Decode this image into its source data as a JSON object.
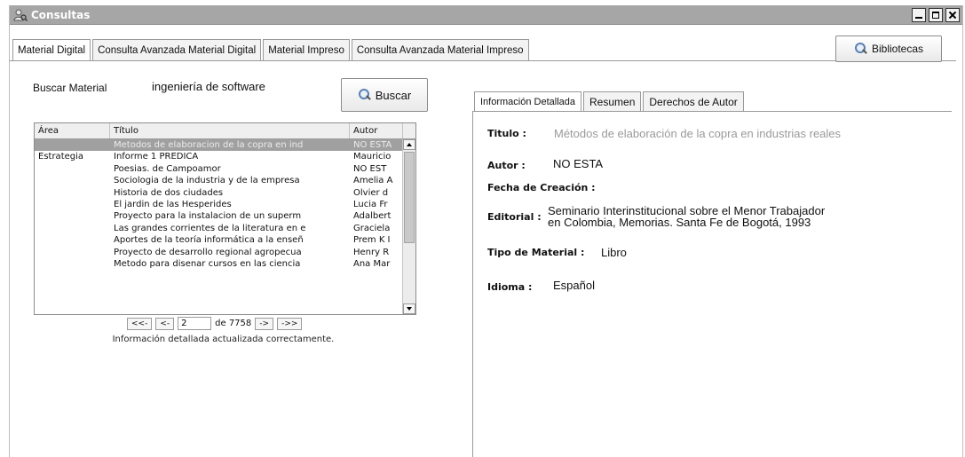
{
  "window": {
    "title": "Consultas"
  },
  "tabs": [
    {
      "label": "Material Digital",
      "active": true
    },
    {
      "label": "Consulta Avanzada Material Digital",
      "active": false
    },
    {
      "label": "Material Impreso",
      "active": false
    },
    {
      "label": "Consulta Avanzada Material Impreso",
      "active": false
    }
  ],
  "bibliotecas_button": "Bibliotecas",
  "search": {
    "label": "Buscar Material",
    "value": "ingeniería de software",
    "button": "Buscar"
  },
  "results_table": {
    "columns": [
      "Área",
      "Título",
      "Autor"
    ],
    "rows": [
      {
        "area": "",
        "titulo": "Metodos de elaboracion de la copra en ind",
        "autor": "NO ESTA",
        "selected": true
      },
      {
        "area": "Estrategia",
        "titulo": "Informe 1 PREDICA",
        "autor": "Mauricio",
        "selected": false
      },
      {
        "area": "",
        "titulo": "Poesias. de Campoamor",
        "autor": "NO EST",
        "selected": false
      },
      {
        "area": "",
        "titulo": "Sociologia de la industria y de la empresa",
        "autor": "Amelia A",
        "selected": false
      },
      {
        "area": "",
        "titulo": "Historia de dos ciudades",
        "autor": "Olvier d",
        "selected": false
      },
      {
        "area": "",
        "titulo": "El jardin de las Hesperides",
        "autor": "Lucia Fr",
        "selected": false
      },
      {
        "area": "",
        "titulo": "Proyecto para la instalacion de un superm",
        "autor": "Adalbert",
        "selected": false
      },
      {
        "area": "",
        "titulo": "Las grandes corrientes de la literatura en e",
        "autor": "Graciela",
        "selected": false
      },
      {
        "area": "",
        "titulo": "Aportes de la teoría informática a la enseñ",
        "autor": "Prem K I",
        "selected": false
      },
      {
        "area": "",
        "titulo": "Proyecto de desarrollo regional agropecua",
        "autor": "Henry R",
        "selected": false
      },
      {
        "area": "",
        "titulo": "Metodo para disenar cursos en las ciencia",
        "autor": "Ana Mar",
        "selected": false
      }
    ]
  },
  "pager": {
    "first": "<<-",
    "prev": "<-",
    "page": "2",
    "of_label": "de 7758",
    "next": "->",
    "last": "->>"
  },
  "status_message": "Información detallada actualizada correctamente.",
  "detail_tabs": [
    {
      "label": "Información Detallada",
      "active": true
    },
    {
      "label": "Resumen",
      "active": false
    },
    {
      "label": "Derechos de Autor",
      "active": false
    }
  ],
  "details": {
    "titulo_label": "Titulo :",
    "titulo_value": "Métodos de elaboración de la copra en industrias reales",
    "autor_label": "Autor :",
    "autor_value": "NO ESTA",
    "fecha_label": "Fecha de Creación :",
    "editorial_label": "Editorial :",
    "editorial_value_line1": "Seminario Interinstitucional sobre el Menor Trabajador",
    "editorial_value_line2": "en Colombia, Memorias. Santa Fe de Bogotá, 1993",
    "tipo_label": "Tipo de Material :",
    "tipo_value": "Libro",
    "idioma_label": "Idioma :",
    "idioma_value": "Español"
  },
  "icons": {
    "app": "person-search-icon",
    "search": "magnifier-icon"
  }
}
